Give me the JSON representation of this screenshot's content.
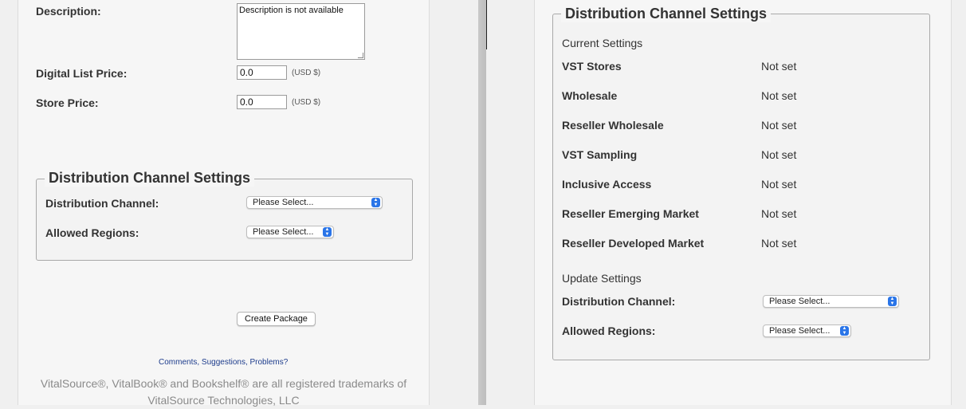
{
  "left": {
    "description": {
      "label": "Description:",
      "value": "Description is not available"
    },
    "digital_list_price": {
      "label": "Digital List Price:",
      "value": "0.0",
      "unit": "(USD $)"
    },
    "store_price": {
      "label": "Store Price:",
      "value": "0.0",
      "unit": "(USD $)"
    },
    "distribution": {
      "legend": "Distribution Channel Settings",
      "channel_label": "Distribution Channel:",
      "channel_select": "Please Select...",
      "regions_label": "Allowed Regions:",
      "regions_select": "Please Select..."
    },
    "create_button": "Create Package",
    "feedback_link": "Comments, Suggestions, Problems?",
    "footer_line1": "VitalSource®, VitalBook® and Bookshelf® are all registered trademarks of",
    "footer_line2": "VitalSource Technologies, LLC"
  },
  "right": {
    "legend": "Distribution Channel Settings",
    "current_heading": "Current Settings",
    "settings": [
      {
        "name": "VST Stores",
        "value": "Not set"
      },
      {
        "name": "Wholesale",
        "value": "Not set"
      },
      {
        "name": "Reseller Wholesale",
        "value": "Not set"
      },
      {
        "name": "VST Sampling",
        "value": "Not set"
      },
      {
        "name": "Inclusive Access",
        "value": "Not set"
      },
      {
        "name": "Reseller Emerging Market",
        "value": "Not set"
      },
      {
        "name": "Reseller Developed Market",
        "value": "Not set"
      }
    ],
    "update_heading": "Update Settings",
    "channel_label": "Distribution Channel:",
    "channel_select": "Please Select...",
    "regions_label": "Allowed Regions:",
    "regions_select": "Please Select..."
  }
}
